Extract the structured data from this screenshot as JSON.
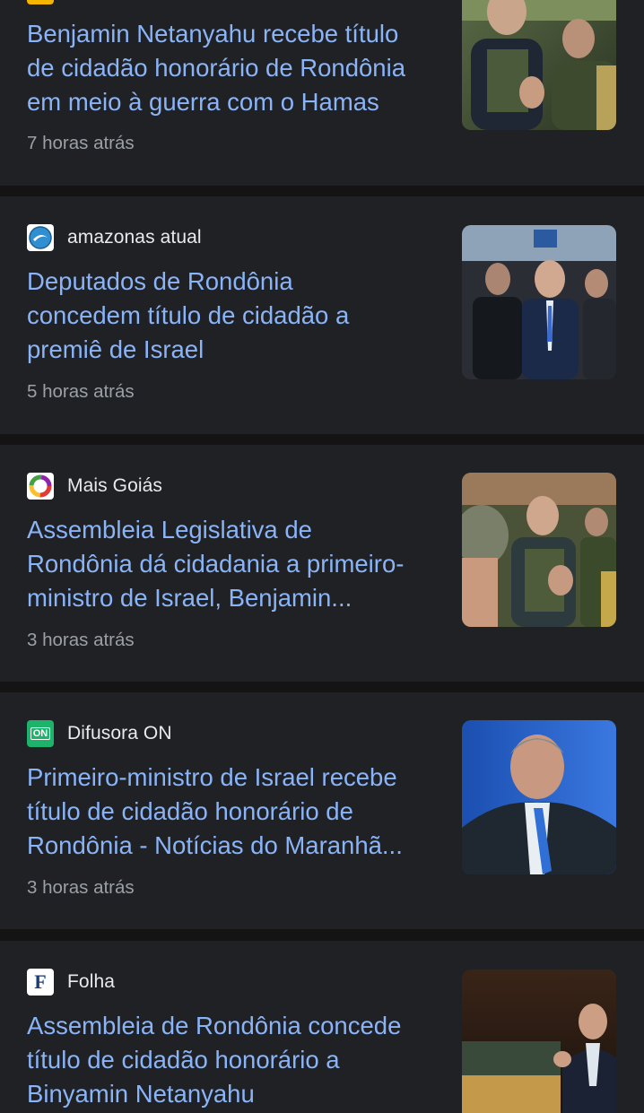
{
  "articles": [
    {
      "source": "",
      "favicon": "partial-yellow-favicon-icon",
      "title_lines": [
        "Benjamin Netanyahu recebe título",
        "de cidadão honorário de Rondônia",
        "em meio à guerra com o Hamas"
      ],
      "time": "7 horas atrás",
      "thumbnail": "netanyahu-with-soldiers-photo"
    },
    {
      "source": "amazonas atual",
      "favicon": "amazonas-atual-favicon-icon",
      "title_lines": [
        "Deputados de Rondônia",
        "concedem título de cidadão a",
        "premiê de Israel"
      ],
      "time": "5 horas atrás",
      "thumbnail": "netanyahu-suit-crowd-photo"
    },
    {
      "source": "Mais Goiás",
      "favicon": "mais-goias-favicon-icon",
      "title_lines": [
        "Assembleia Legislativa de",
        "Rondônia dá cidadania a primeiro-",
        "ministro de Israel, Benjamin..."
      ],
      "time": "3 horas atrás",
      "thumbnail": "netanyahu-soldiers-helmet-photo"
    },
    {
      "source": "Difusora ON",
      "favicon_text": "ON",
      "favicon": "difusora-on-favicon-icon",
      "title_lines": [
        "Primeiro-ministro de Israel recebe",
        "título de cidadão honorário de",
        "Rondônia - Notícias do Maranhã..."
      ],
      "time": "3 horas atrás",
      "thumbnail": "netanyahu-portrait-blue-background-photo"
    },
    {
      "source": "Folha",
      "favicon_text": "F",
      "favicon": "folha-favicon-icon",
      "title_lines": [
        "Assembleia de Rondônia concede",
        "título de cidadão honorário a",
        "Binyamin Netanyahu"
      ],
      "time": "",
      "thumbnail": "netanyahu-podium-speech-photo"
    }
  ],
  "colors": {
    "card_bg": "#202124",
    "divider": "#141414",
    "headline": "#8ab4f8",
    "source_text": "#e8eaed",
    "time_text": "#9aa0a6"
  }
}
